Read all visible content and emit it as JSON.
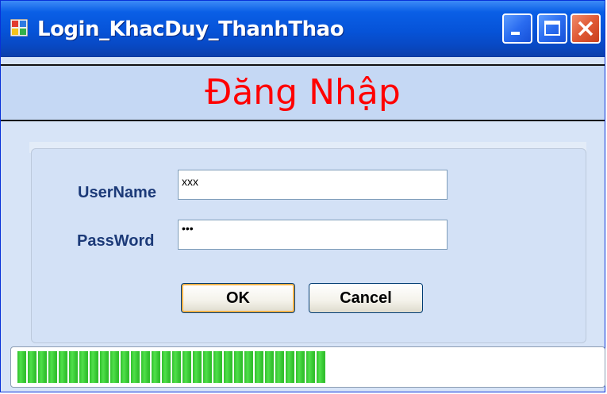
{
  "window": {
    "title": "Login_KhacDuy_ThanhThao",
    "icons": {
      "app": "app-icon",
      "minimize": "minimize-icon",
      "maximize": "maximize-icon",
      "close": "close-icon"
    }
  },
  "header": {
    "title": "Đăng Nhập",
    "title_color": "#ff0000"
  },
  "form": {
    "username_label": "UserName",
    "username_value": "xxx",
    "password_label": "PassWord",
    "password_value": "•••",
    "ok_label": "OK",
    "cancel_label": "Cancel"
  },
  "progress": {
    "value_percent": 53,
    "color": "#32c12e"
  }
}
